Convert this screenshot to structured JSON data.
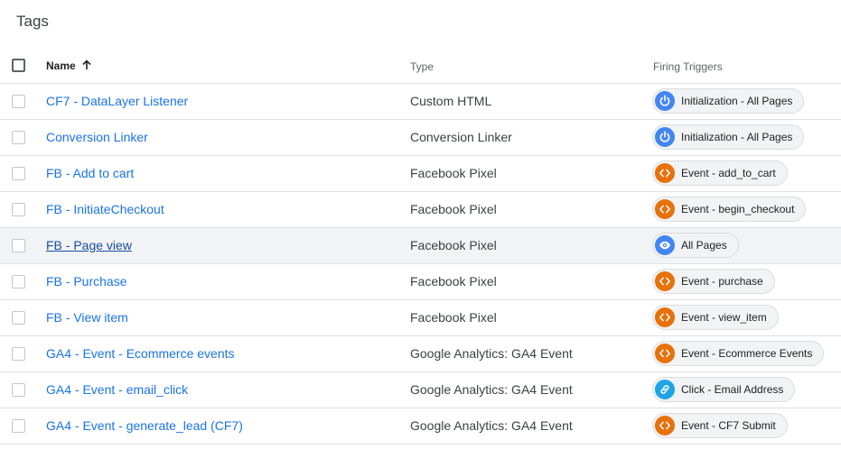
{
  "page": {
    "title": "Tags"
  },
  "table": {
    "headers": {
      "name": "Name",
      "type": "Type",
      "triggers": "Firing Triggers"
    },
    "rows": [
      {
        "name": "CF7 - DataLayer Listener",
        "type": "Custom HTML",
        "trigger": "Initialization - All Pages",
        "trigger_icon": "power-icon",
        "trigger_color": "#4285f4"
      },
      {
        "name": "Conversion Linker",
        "type": "Conversion Linker",
        "trigger": "Initialization - All Pages",
        "trigger_icon": "power-icon",
        "trigger_color": "#4285f4"
      },
      {
        "name": "FB - Add to cart",
        "type": "Facebook Pixel",
        "trigger": "Event - add_to_cart",
        "trigger_icon": "code-brackets-icon",
        "trigger_color": "#e8710a"
      },
      {
        "name": "FB - InitiateCheckout",
        "type": "Facebook Pixel",
        "trigger": "Event - begin_checkout",
        "trigger_icon": "code-brackets-icon",
        "trigger_color": "#e8710a"
      },
      {
        "name": "FB - Page view",
        "type": "Facebook Pixel",
        "trigger": "All Pages",
        "trigger_icon": "eye-icon",
        "trigger_color": "#4285f4"
      },
      {
        "name": "FB - Purchase",
        "type": "Facebook Pixel",
        "trigger": "Event - purchase",
        "trigger_icon": "code-brackets-icon",
        "trigger_color": "#e8710a"
      },
      {
        "name": "FB - View item",
        "type": "Facebook Pixel",
        "trigger": "Event - view_item",
        "trigger_icon": "code-brackets-icon",
        "trigger_color": "#e8710a"
      },
      {
        "name": "GA4 - Event - Ecommerce events",
        "type": "Google Analytics: GA4 Event",
        "trigger": "Event - Ecommerce Events",
        "trigger_icon": "code-brackets-icon",
        "trigger_color": "#e8710a"
      },
      {
        "name": "GA4 - Event - email_click",
        "type": "Google Analytics: GA4 Event",
        "trigger": "Click - Email Address",
        "trigger_icon": "link-icon",
        "trigger_color": "#1ea4e9"
      },
      {
        "name": "GA4 - Event - generate_lead (CF7)",
        "type": "Google Analytics: GA4 Event",
        "trigger": "Event - CF7 Submit",
        "trigger_icon": "code-brackets-icon",
        "trigger_color": "#e8710a"
      }
    ]
  },
  "colors": {
    "link": "#1a73e8",
    "hover_row_bg": "#f1f3f4",
    "event_trigger": "#e8710a",
    "pageview_trigger": "#4285f4",
    "click_trigger": "#1ea4e9"
  }
}
